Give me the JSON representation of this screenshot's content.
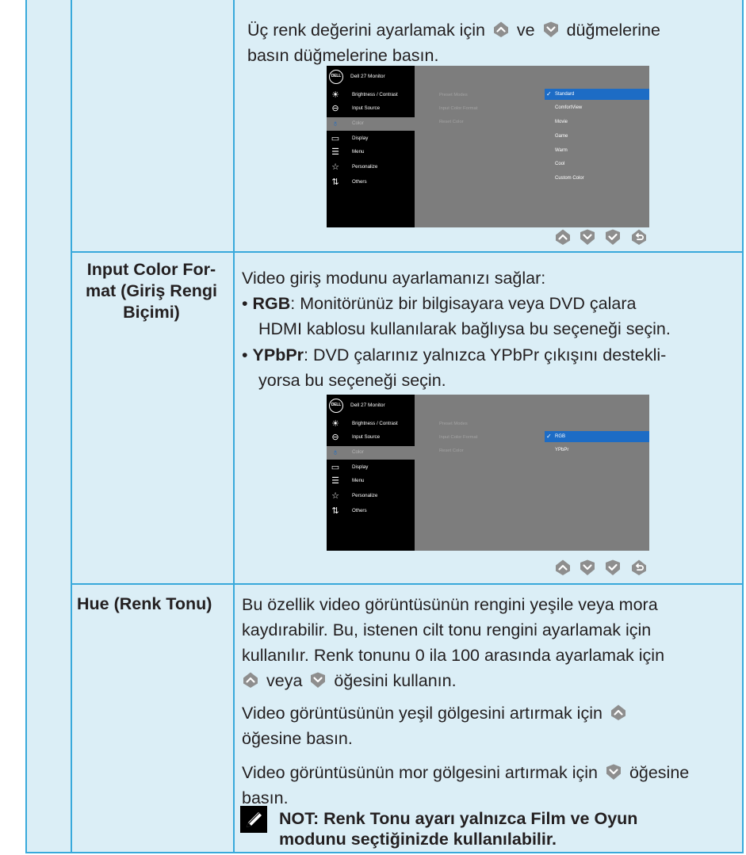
{
  "colors": {
    "cell_bg": "#dbeef6",
    "border": "#38a9db",
    "text": "#231f20",
    "osd_bg": "#7d7d7d",
    "osd_sidebar": "#000000",
    "osd_highlight": "#1d6cc5",
    "arrow_icon": "#8e8e8e"
  },
  "row1": {
    "line1_a": "Üç renk değerini ayarlamak için",
    "line1_b": "ve",
    "line1_c": "düğmelerine",
    "line2": "basın düğmelerine basın."
  },
  "osd_common": {
    "logo": "DELL",
    "title": "Dell 27 Monitor",
    "menu": [
      {
        "label": "Brightness / Contrast",
        "icon": "sun-icon",
        "glyph": "☀"
      },
      {
        "label": "Input Source",
        "icon": "input-source-icon",
        "glyph": "⊖"
      },
      {
        "label": "Color",
        "icon": "color-drop-icon",
        "glyph": "♁"
      },
      {
        "label": "Display",
        "icon": "display-icon",
        "glyph": "▭"
      },
      {
        "label": "Menu",
        "icon": "menu-icon",
        "glyph": "☰"
      },
      {
        "label": "Personalize",
        "icon": "star-icon",
        "glyph": "☆"
      },
      {
        "label": "Others",
        "icon": "others-icon",
        "glyph": "⇅"
      }
    ],
    "submenu": [
      "Preset Modes",
      "Input Color Format",
      "Reset Color"
    ]
  },
  "osd1": {
    "options": [
      "Standard",
      "ComfortView",
      "Movie",
      "Game",
      "Warm",
      "Cool",
      "Custom Color"
    ]
  },
  "osd2": {
    "options": [
      "RGB",
      "YPbPr"
    ]
  },
  "row2": {
    "label_l1": "Input Color For-",
    "label_l2": "mat (Giriş Rengi",
    "label_l3": "Biçimi)",
    "intro": "Video giriş modunu ayarlamanızı sağlar:",
    "rgb_term": "RGB",
    "rgb_l1": ": Monitörünüz bir bilgisayara veya DVD çalara",
    "rgb_l2": "HDMI kablosu kullanılarak bağlıysa bu seçeneği seçin.",
    "ypbpr_term": "YPbPr",
    "ypbpr_l1": ": DVD çalarınız yalnızca YPbPr çıkışını destekli-",
    "ypbpr_l2": "yorsa bu seçeneği seçin."
  },
  "row3": {
    "label": "Hue (Renk Tonu)",
    "p1_l1": "Bu özellik video görüntüsünün rengini yeşile veya mora",
    "p1_l2": "kaydırabilir. Bu, istenen cilt tonu rengini ayarlamak için",
    "p1_l3": "kullanılır. Renk tonunu 0 ila 100 arasında ayarlamak için",
    "p1_l4_a": "veya",
    "p1_l4_b": "öğesini kullanın.",
    "p2_l1": "Video görüntüsünün yeşil gölgesini artırmak için",
    "p2_l2": "öğesine basın.",
    "p3_l1": "Video görüntüsünün mor gölgesini artırmak için",
    "p3_l1_b": "öğesine",
    "p3_l2": "basın.",
    "note_l1": "NOT: Renk Tonu ayarı yalnızca Film ve Oyun",
    "note_l2": "modunu seçtiğinizde kullanılabilir."
  }
}
